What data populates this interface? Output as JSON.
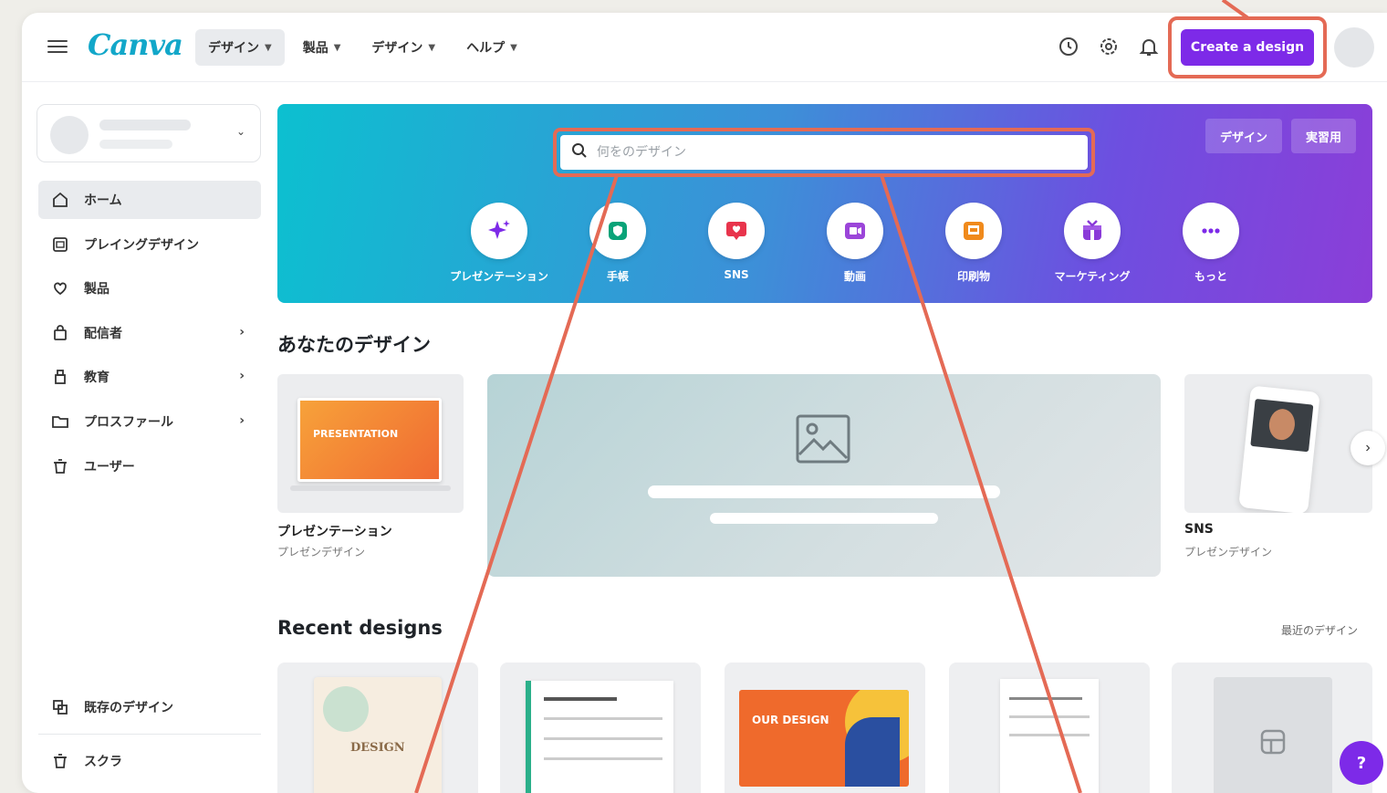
{
  "topbar": {
    "logo": "Canva",
    "nav": [
      {
        "label": "デザイン"
      },
      {
        "label": "製品"
      },
      {
        "label": "デザイン"
      },
      {
        "label": "ヘルプ"
      }
    ],
    "create_button": "Create a design",
    "icons": [
      "clock-icon",
      "settings-icon",
      "bell-icon"
    ]
  },
  "sidebar": {
    "items": [
      {
        "label": "ホーム",
        "icon": "home-icon"
      },
      {
        "label": "プレイングデザイン",
        "icon": "template-icon"
      },
      {
        "label": "製品",
        "icon": "heart-icon"
      },
      {
        "label": "配信者",
        "icon": "bag-icon"
      },
      {
        "label": "教育",
        "icon": "tool-icon"
      },
      {
        "label": "プロスファール",
        "icon": "folder-icon"
      },
      {
        "label": "ユーザー",
        "icon": "trash-icon"
      }
    ],
    "bottom": [
      {
        "label": "既存のデザイン",
        "icon": "copy-icon"
      },
      {
        "label": "スクラ",
        "icon": "trash-icon"
      }
    ]
  },
  "hero": {
    "tabs": [
      "デザイン",
      "実習用"
    ],
    "search_placeholder": "何をのデザイン",
    "shortcuts": [
      {
        "label": "プレゼンテーション",
        "icon": "sparkle-icon",
        "color": "#7d2ae8"
      },
      {
        "label": "手帳",
        "icon": "shield-icon",
        "color": "#0aa378"
      },
      {
        "label": "SNS",
        "icon": "heart-icon",
        "color": "#e8344c"
      },
      {
        "label": "動画",
        "icon": "video-icon",
        "color": "#9b45d9"
      },
      {
        "label": "印刷物",
        "icon": "print-icon",
        "color": "#f08a1c"
      },
      {
        "label": "マーケティング",
        "icon": "gift-icon",
        "color": "#8a3ad8"
      },
      {
        "label": "もっと",
        "icon": "more-icon",
        "color": "#7d2ae8"
      }
    ]
  },
  "your_designs": {
    "title": "あなたのデザイン",
    "cards": [
      {
        "title": "プレゼンテーション",
        "subtitle": "プレゼンデザイン",
        "thumb_text": "PRESENTATION"
      },
      {
        "title": "SNS",
        "subtitle": "プレゼンデザイン"
      }
    ]
  },
  "recent": {
    "title": "Recent designs",
    "see_all": "最近のデザイン",
    "cards": [
      {
        "thumb_text": "DESIGN"
      },
      {
        "thumb_text": ""
      },
      {
        "thumb_text": "OUR DESIGN"
      },
      {
        "thumb_text": ""
      },
      {
        "thumb_text": ""
      }
    ]
  },
  "help_label": "?",
  "colors": {
    "brand": "#7d2ae8",
    "logo": "#12a7c9",
    "callout": "#e46a55"
  }
}
